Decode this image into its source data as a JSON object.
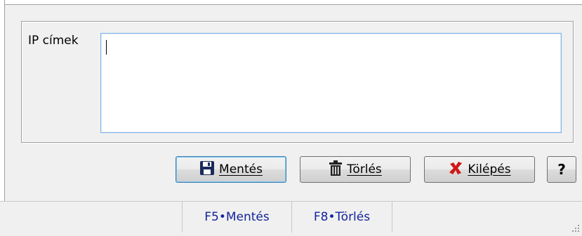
{
  "form": {
    "ip_label": "IP címek",
    "ip_value": ""
  },
  "buttons": {
    "save_label": "Mentés",
    "delete_label": "Törlés",
    "exit_label": "Kilépés",
    "help_label": "?"
  },
  "statusbar": {
    "f5": "F5•Mentés",
    "f8": "F8•Törlés"
  },
  "icons": {
    "save": "floppy-disk-icon",
    "delete": "trash-can-icon",
    "exit": "red-x-icon",
    "resize": "size-grip-icon"
  },
  "colors": {
    "status_text": "#14249b",
    "exit_icon": "#d01818",
    "save_icon": "#1a2a5a"
  }
}
